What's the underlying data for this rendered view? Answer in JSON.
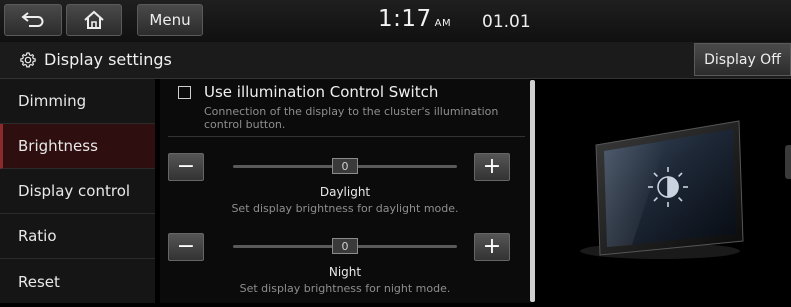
{
  "header": {
    "menu_label": "Menu",
    "time": "1:17",
    "ampm": "AM",
    "date": "01.01"
  },
  "titlebar": {
    "title": "Display settings",
    "display_off_label": "Display Off"
  },
  "sidebar": {
    "items": [
      {
        "label": "Dimming"
      },
      {
        "label": "Brightness"
      },
      {
        "label": "Display control"
      },
      {
        "label": "Ratio"
      },
      {
        "label": "Reset"
      }
    ],
    "active_index": 1
  },
  "content": {
    "illumination": {
      "label": "Use illumination Control Switch",
      "description": "Connection of the display to the cluster's illumination control button.",
      "checked": false
    },
    "daylight": {
      "value": "0",
      "title": "Daylight",
      "description": "Set display brightness for daylight mode."
    },
    "night": {
      "value": "0",
      "title": "Night",
      "description": "Set display brightness for night mode."
    },
    "minus_glyph": "−",
    "plus_glyph": "+"
  },
  "icons": {
    "back": "back-arrow-icon",
    "home": "home-icon",
    "settings": "gear-icon",
    "preview": "brightness-icon"
  },
  "colors": {
    "active_item_bg": "#2e0e0e",
    "active_item_accent": "#8a2a2a"
  }
}
